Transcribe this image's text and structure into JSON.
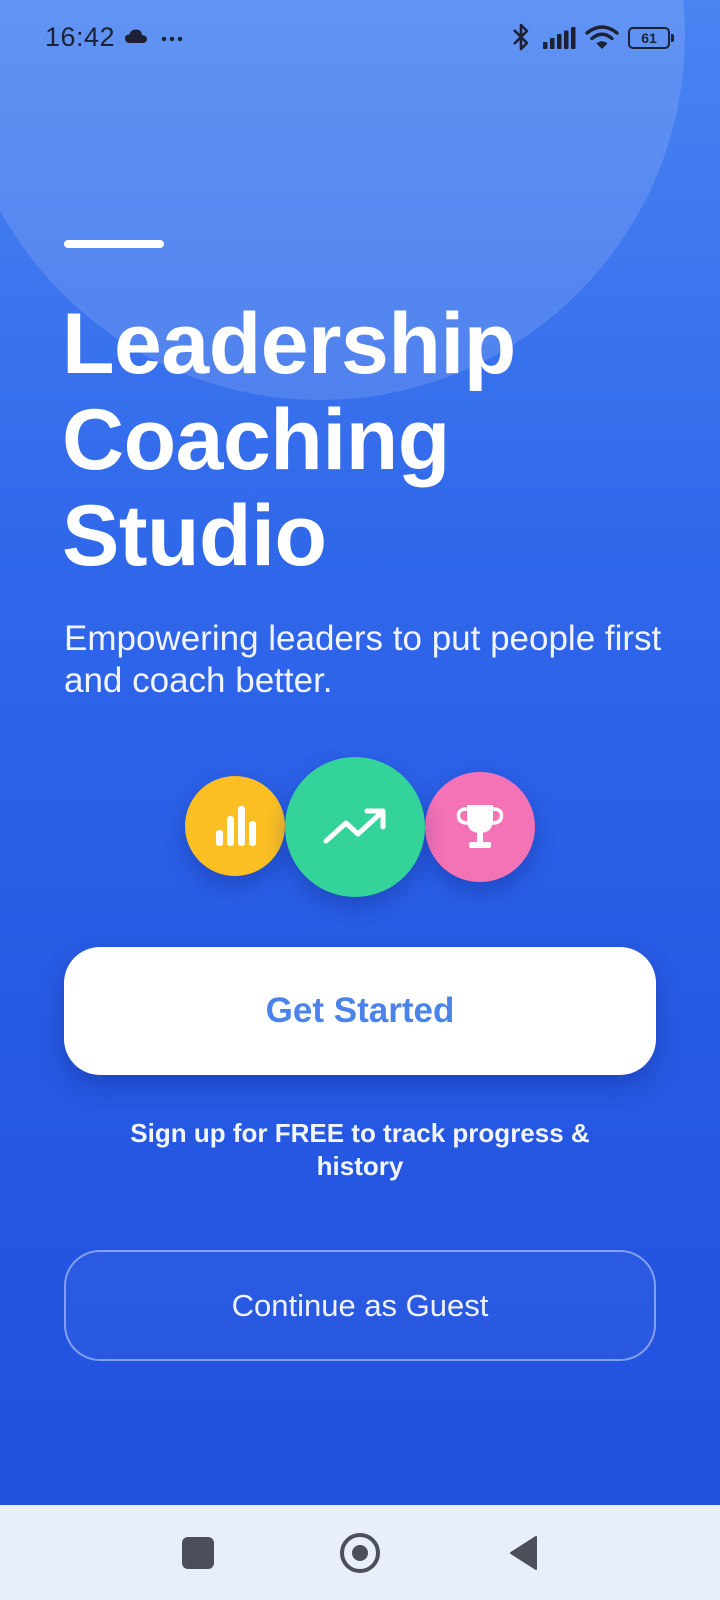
{
  "status_bar": {
    "time": "16:42",
    "more": "···",
    "battery_level": "61",
    "icons": [
      "cloud-icon",
      "more-icon",
      "bluetooth-icon",
      "signal-icon",
      "wifi-icon",
      "battery-icon"
    ]
  },
  "hero": {
    "title_lines": [
      "Leadership",
      "Coaching",
      "Studio"
    ],
    "subtitle": "Empowering leaders to put people first and coach better."
  },
  "feature_icons": [
    "bar-chart-icon",
    "trending-up-icon",
    "trophy-icon"
  ],
  "actions": {
    "primary_label": "Get Started",
    "signup_note": "Sign up for FREE to track progress & history",
    "secondary_label": "Continue as Guest"
  },
  "nav_bar": {
    "icons": [
      "recent-apps-icon",
      "home-icon",
      "back-icon"
    ]
  },
  "colors": {
    "background_top": "#4a84f2",
    "background_bottom": "#214fdc",
    "accent_text": "#4a84ea",
    "yellow": "#fbbf24",
    "green": "#34d399",
    "pink": "#f472b6",
    "nav_bar": "#e9eefc"
  }
}
